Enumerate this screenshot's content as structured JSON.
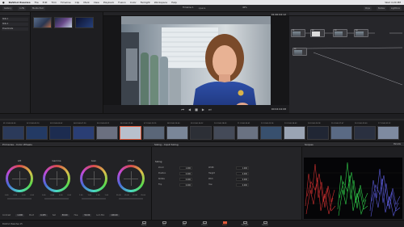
{
  "menubar": {
    "apple": "",
    "items": [
      "DaVinci Resolve",
      "File",
      "Edit",
      "Trim",
      "Timeline",
      "Clip",
      "Mark",
      "View",
      "Playback",
      "Fusion",
      "Color",
      "Fairlight",
      "Workspace",
      "Help"
    ],
    "clock": "Wed 4:20 PM"
  },
  "toolbar": {
    "left": [
      "Gallery",
      "LUTs",
      "Media Pool"
    ],
    "project_title": "opera",
    "timeline_name": "Timeline 1",
    "zoom": "40%",
    "right": [
      "Clips",
      "Nodes",
      "Lightbox"
    ]
  },
  "gallery": {
    "items": [
      "Stills 1",
      "Stills 2",
      "PowerGrade"
    ]
  },
  "viewer": {
    "timecode": "01:00:04:12",
    "clip_tc": "00:04:04:08",
    "controls": [
      "⏮",
      "◀",
      "■",
      "▶",
      "⏭"
    ]
  },
  "nodes": {
    "list": [
      "01",
      "02",
      "03",
      "04",
      "05"
    ]
  },
  "clips": [
    {
      "name": "01 01:00:00:00",
      "color": "#2b3a5a"
    },
    {
      "name": "02 01:00:03:10",
      "color": "#233a64"
    },
    {
      "name": "03 01:00:05:02",
      "color": "#1c2c50"
    },
    {
      "name": "04 01:00:07:20",
      "color": "#2a3e74"
    },
    {
      "name": "05 01:00:09:11",
      "color": "#6b7080"
    },
    {
      "name": "06 01:00:11:04",
      "color": "#b8c0cc"
    },
    {
      "name": "07 01:00:13:15",
      "color": "#5a6678"
    },
    {
      "name": "08 01:00:15:00",
      "color": "#7a8698"
    },
    {
      "name": "09 01:00:16:22",
      "color": "#2c2f36"
    },
    {
      "name": "10 01:00:18:09",
      "color": "#444a58"
    },
    {
      "name": "11 01:00:20:01",
      "color": "#6a7282"
    },
    {
      "name": "12 01:00:22:14",
      "color": "#38506e"
    },
    {
      "name": "13 01:00:24:03",
      "color": "#9aa4b4"
    },
    {
      "name": "14 01:00:25:18",
      "color": "#202634"
    },
    {
      "name": "15 01:00:27:07",
      "color": "#5a6a84"
    },
    {
      "name": "16 01:00:29:00",
      "color": "#2a3040"
    },
    {
      "name": "17 01:00:31:12",
      "color": "#7e8aa0"
    }
  ],
  "wheels": {
    "title": "Primaries - Color Wheels",
    "items": [
      {
        "label": "Lift",
        "vals": [
          "0.00",
          "0.00",
          "0.00",
          "0.00"
        ]
      },
      {
        "label": "Gamma",
        "vals": [
          "0.00",
          "0.00",
          "0.00",
          "0.00"
        ]
      },
      {
        "label": "Gain",
        "vals": [
          "1.00",
          "1.00",
          "1.00",
          "1.00"
        ]
      },
      {
        "label": "Offset",
        "vals": [
          "25.00",
          "25.00",
          "25.00",
          "25.00"
        ]
      }
    ],
    "bottom": {
      "contrast_label": "Contrast",
      "contrast": "1.000",
      "pivot_label": "Pivot",
      "pivot": "0.435",
      "sat_label": "Sat",
      "sat": "50.00",
      "hue_label": "Hue",
      "hue": "50.00",
      "lum_label": "Lum Mix",
      "lum": "100.00"
    }
  },
  "midpanel": {
    "title": "Sizing - Input Sizing",
    "section": "Sizing",
    "rows": [
      {
        "label": "Zoom",
        "v1": "1.000",
        "label2": "Width",
        "v2": "1.000"
      },
      {
        "label": "Position",
        "v1": "0.000",
        "label2": "Height",
        "v2": "0.000"
      },
      {
        "label": "Rotate",
        "v1": "0.000",
        "label2": "Pitch",
        "v2": "0.000"
      },
      {
        "label": "Flip",
        "v1": "0.000",
        "label2": "Yaw",
        "v2": "0.000"
      }
    ]
  },
  "scopes": {
    "title": "Scopes",
    "mode": "Parade"
  },
  "pagebar": {
    "app": "DaVinci Resolve 15",
    "tabs": [
      "Media",
      "Cut",
      "Edit",
      "Fusion",
      "Color",
      "Fairlight",
      "Deliver"
    ],
    "active": "Color"
  },
  "colors": {
    "accent": "#e15a3a",
    "panel": "#222225"
  }
}
